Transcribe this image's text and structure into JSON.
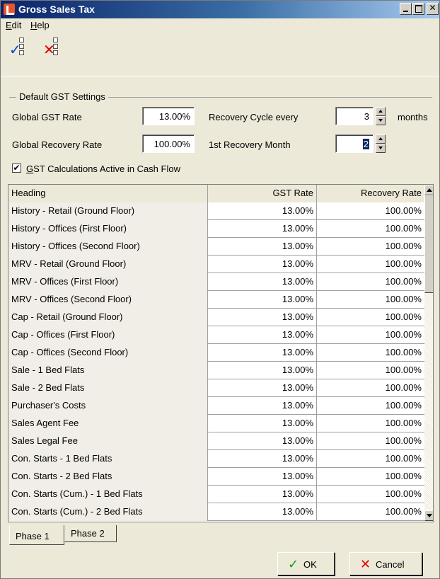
{
  "window": {
    "title": "Gross Sales Tax"
  },
  "menu": [
    {
      "label": "Edit",
      "u": "E",
      "rest": "dit"
    },
    {
      "label": "Help",
      "u": "H",
      "rest": "elp"
    }
  ],
  "toolbar": {
    "select_all_icon": "check-list-icon",
    "deselect_all_icon": "x-list-icon"
  },
  "settings": {
    "legend": "Default GST Settings",
    "global_gst_rate_label": "Global GST Rate",
    "global_gst_rate_value": "13.00%",
    "global_recovery_rate_label": "Global Recovery Rate",
    "global_recovery_rate_value": "100.00%",
    "recovery_cycle_label": "Recovery Cycle every",
    "recovery_cycle_value": "3",
    "recovery_cycle_unit": "months",
    "first_recovery_month_label": "1st Recovery Month",
    "first_recovery_month_value": "2",
    "gst_active_checked": true,
    "gst_active_label_u": "G",
    "gst_active_label_rest": "ST Calculations Active in Cash Flow"
  },
  "table": {
    "columns": [
      "Heading",
      "GST Rate",
      "Recovery Rate"
    ],
    "rows": [
      [
        "History - Retail (Ground Floor)",
        "13.00%",
        "100.00%"
      ],
      [
        "History - Offices (First Floor)",
        "13.00%",
        "100.00%"
      ],
      [
        "History - Offices (Second Floor)",
        "13.00%",
        "100.00%"
      ],
      [
        "MRV - Retail (Ground Floor)",
        "13.00%",
        "100.00%"
      ],
      [
        "MRV - Offices (First Floor)",
        "13.00%",
        "100.00%"
      ],
      [
        "MRV - Offices (Second Floor)",
        "13.00%",
        "100.00%"
      ],
      [
        "Cap - Retail (Ground Floor)",
        "13.00%",
        "100.00%"
      ],
      [
        "Cap - Offices (First Floor)",
        "13.00%",
        "100.00%"
      ],
      [
        "Cap - Offices (Second Floor)",
        "13.00%",
        "100.00%"
      ],
      [
        "Sale - 1 Bed Flats",
        "13.00%",
        "100.00%"
      ],
      [
        "Sale - 2 Bed Flats",
        "13.00%",
        "100.00%"
      ],
      [
        "Purchaser's Costs",
        "13.00%",
        "100.00%"
      ],
      [
        "Sales Agent Fee",
        "13.00%",
        "100.00%"
      ],
      [
        "Sales Legal Fee",
        "13.00%",
        "100.00%"
      ],
      [
        "Con. Starts - 1 Bed Flats",
        "13.00%",
        "100.00%"
      ],
      [
        "Con. Starts - 2 Bed Flats",
        "13.00%",
        "100.00%"
      ],
      [
        "Con. Starts (Cum.) - 1 Bed Flats",
        "13.00%",
        "100.00%"
      ],
      [
        "Con. Starts (Cum.) - 2 Bed Flats",
        "13.00%",
        "100.00%"
      ]
    ]
  },
  "tabs": [
    {
      "label": "Phase 1",
      "active": true
    },
    {
      "label": "Phase 2",
      "active": false
    }
  ],
  "buttons": {
    "ok": "OK",
    "cancel": "Cancel"
  },
  "colors": {
    "ok_check": "#1a9a1a",
    "cancel_x": "#e00000",
    "selection": "#0a246a"
  }
}
